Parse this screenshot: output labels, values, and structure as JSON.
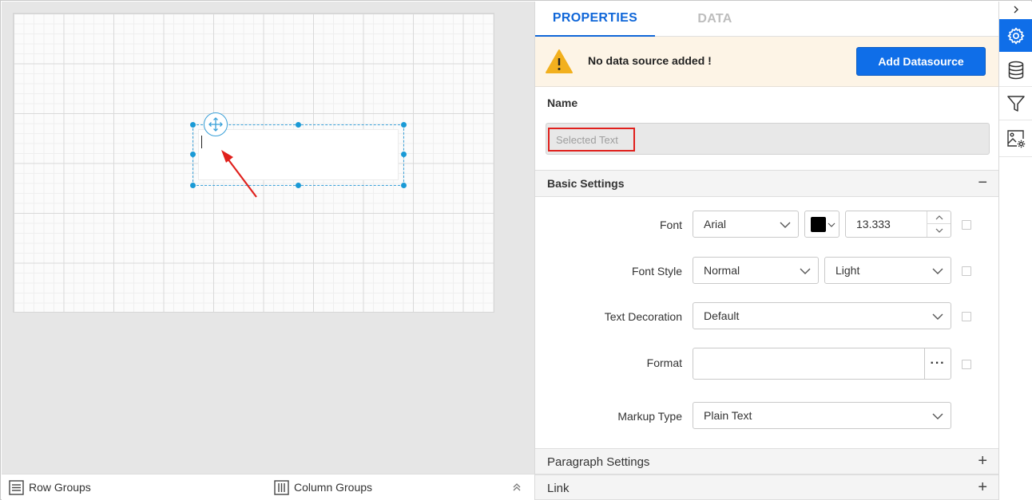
{
  "tabs": {
    "properties": "PROPERTIES",
    "data": "DATA"
  },
  "warning": {
    "message": "No data source added !",
    "button": "Add Datasource"
  },
  "name": {
    "label": "Name",
    "value": "Selected Text"
  },
  "sections": {
    "basic_settings": "Basic Settings",
    "paragraph_settings": "Paragraph Settings",
    "link": "Link",
    "expanded_toggle": "−",
    "collapsed_toggle": "+"
  },
  "basic": {
    "font_label": "Font",
    "font_value": "Arial",
    "font_color": "#000000",
    "font_size": "13.333",
    "font_style_label": "Font Style",
    "font_style_value": "Normal",
    "font_weight_value": "Light",
    "text_decoration_label": "Text Decoration",
    "text_decoration_value": "Default",
    "format_label": "Format",
    "format_value": "",
    "format_button": "···",
    "markup_type_label": "Markup Type",
    "markup_type_value": "Plain Text"
  },
  "groupbar": {
    "row_groups": "Row Groups",
    "column_groups": "Column Groups"
  },
  "colors": {
    "accent": "#0f6ee8",
    "selection": "#1a9ad6",
    "warning_bg": "#fdf4e6",
    "warning_icon": "#f2b01e",
    "highlight": "#e0201c"
  }
}
